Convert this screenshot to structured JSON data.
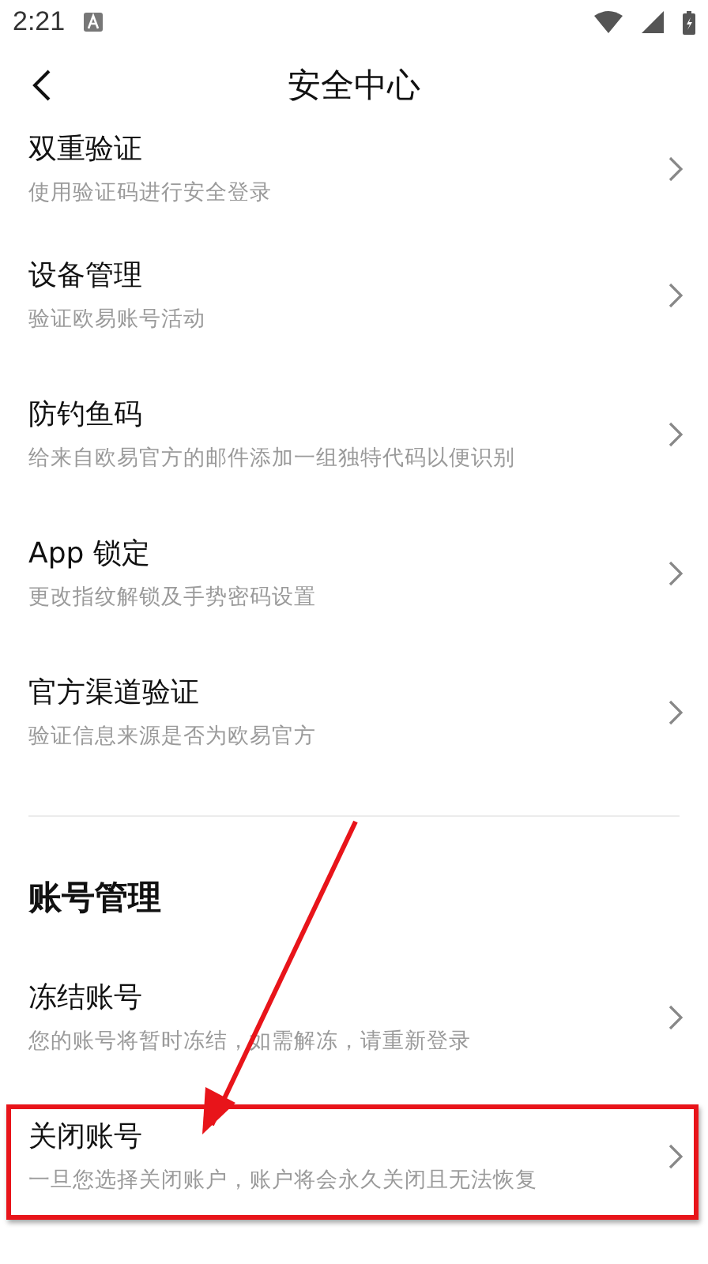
{
  "status_bar": {
    "time": "2:21"
  },
  "header": {
    "title": "安全中心"
  },
  "sections": [
    {
      "items": [
        {
          "title": "双重验证",
          "subtitle": "使用验证码进行安全登录",
          "highlighted": false
        },
        {
          "title": "设备管理",
          "subtitle": "验证欧易账号活动",
          "highlighted": false
        },
        {
          "title": "防钓鱼码",
          "subtitle": "给来自欧易官方的邮件添加一组独特代码以便识别",
          "highlighted": false
        },
        {
          "title": "App 锁定",
          "subtitle": "更改指纹解锁及手势密码设置",
          "highlighted": false
        },
        {
          "title": "官方渠道验证",
          "subtitle": "验证信息来源是否为欧易官方",
          "highlighted": false
        }
      ]
    },
    {
      "heading": "账号管理",
      "items": [
        {
          "title": "冻结账号",
          "subtitle": "您的账号将暂时冻结，如需解冻，请重新登录",
          "highlighted": false
        },
        {
          "title": "关闭账号",
          "subtitle": "一旦您选择关闭账户，账户将会永久关闭且无法恢复",
          "highlighted": true
        }
      ]
    }
  ]
}
